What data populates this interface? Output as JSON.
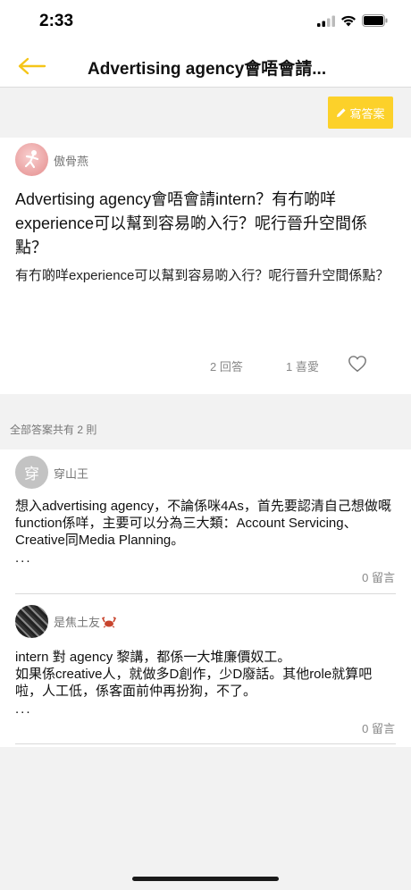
{
  "status": {
    "time": "2:33"
  },
  "nav": {
    "title": "Advertising agency會唔會請..."
  },
  "write_button": {
    "label": "寫答案",
    "icon": "pencil-icon"
  },
  "question": {
    "author": "傲骨燕",
    "title": "Advertising agency會唔會請intern？有冇啲咩experience可以幫到容易啲入行？呢行晉升空間係點？",
    "body": "有冇啲咩experience可以幫到容易啲入行？呢行晉升空間係點？",
    "answers_label": "2 回答",
    "likes_label": "1 喜愛"
  },
  "answers_count_label": "全部答案共有 2 則",
  "answers": [
    {
      "avatar_char": "穿",
      "author": "穿山王",
      "body": "想入advertising agency，不論係咪4As，首先要認清自己想做嘅function係咩，主要可以分為三大類：Account Servicing、Creative同Media Planning。",
      "ellipsis": "...",
      "comments": "0 留言"
    },
    {
      "author": "是焦土友",
      "body": "intern 對 agency 黎講，都係一大堆廉價奴工。\n如果係creative人，就做多D創作，少D廢話。其他role就算吧啦，人工低，係客面前仲再扮狗，不了。",
      "ellipsis": "...",
      "comments": "0 留言"
    }
  ],
  "colors": {
    "accent": "#fcd12a",
    "back_arrow": "#f5c518"
  }
}
